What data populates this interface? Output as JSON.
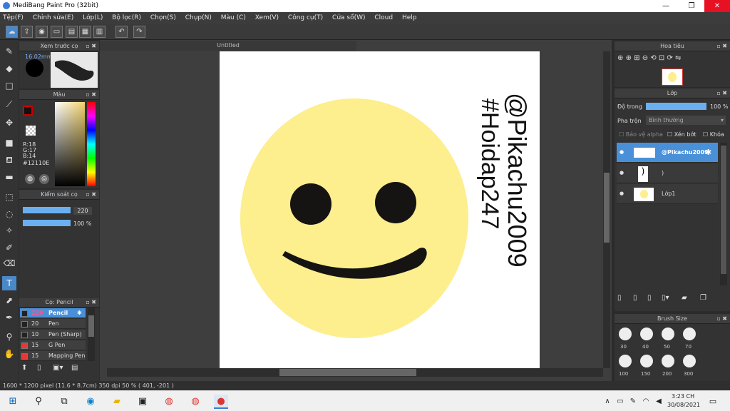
{
  "window": {
    "title": "MediBang Paint Pro (32bit)"
  },
  "menu": [
    "Tệp(F)",
    "Chỉnh sửa(E)",
    "Lớp(L)",
    "Bộ lọc(R)",
    "Chọn(S)",
    "Chụp(N)",
    "Màu (C)",
    "Xem(V)",
    "Công cụ(T)",
    "Cửa sổ(W)",
    "Cloud",
    "Help"
  ],
  "preview": {
    "title": "Xem trước cọ",
    "size": "16.02mm"
  },
  "color": {
    "title": "Màu",
    "r": "R:18",
    "g": "G:17",
    "b": "B:14",
    "hex": "#12110E"
  },
  "brushctrl": {
    "title": "Kiểm soát cọ",
    "size": "220",
    "opacity": "100 %"
  },
  "brushes": {
    "title": "Cọ: Pencil",
    "items": [
      {
        "size": "220",
        "name": "Pencil",
        "color": "#222222"
      },
      {
        "size": "20",
        "name": "Pen",
        "color": "#222222"
      },
      {
        "size": "10",
        "name": "Pen (Sharp)",
        "color": "#222222"
      },
      {
        "size": "15",
        "name": "G Pen",
        "color": "#e53935"
      },
      {
        "size": "15",
        "name": "Mapping Pen",
        "color": "#e53935"
      }
    ]
  },
  "doc": {
    "tab": "Untitled",
    "line1": "@Pikachu2009",
    "line2": "#Hoidap247"
  },
  "navigator": {
    "title": "Hoa tiêu"
  },
  "layers": {
    "title": "Lớp",
    "opacity_label": "Độ trong",
    "opacity": "100 %",
    "blend_label": "Pha trộn",
    "blend": "Bình thường",
    "alpha": "Bảo vệ alpha",
    "clip": "Xén bớt",
    "lock": "Khóa",
    "items": [
      {
        "name": "@Pikachu2009"
      },
      {
        "name": ")"
      },
      {
        "name": "Lớp1"
      }
    ]
  },
  "brushsize": {
    "title": "Brush Size",
    "sizes": [
      "30",
      "40",
      "50",
      "70",
      "100",
      "150",
      "200",
      "300"
    ]
  },
  "status": "1600 * 1200 pixel   (11.6 * 8.7cm)   350 dpi   50 %   ( 401, -201 )",
  "clock": {
    "time": "3:23 CH",
    "date": "30/08/2021"
  },
  "colors": {
    "accent": "#4a90d9",
    "face": "#fdee8e"
  }
}
